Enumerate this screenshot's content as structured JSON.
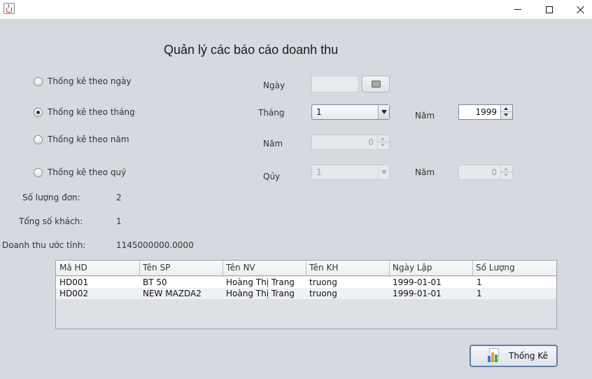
{
  "window": {
    "controls": [
      "minimize",
      "maximize",
      "close"
    ]
  },
  "page_title": "Quản lý các báo cáo doanh thu",
  "radios": [
    {
      "label": "Thống kê theo ngày",
      "selected": false
    },
    {
      "label": "Thống kê theo tháng",
      "selected": true
    },
    {
      "label": "Thống kê theo năm",
      "selected": false
    },
    {
      "label": "Thống kê theo quý",
      "selected": false
    }
  ],
  "filters": {
    "day_label": "Ngày",
    "day_value": "",
    "month_label": "Tháng",
    "month_value": "1",
    "month_year_label": "Năm",
    "month_year_value": "1999",
    "year_label": "Năm",
    "year_value": "0",
    "quarter_label": "Qúy",
    "quarter_value": "1",
    "quarter_year_label": "Năm",
    "quarter_year_value": "0"
  },
  "stats": {
    "orders_label": "Số lượng đơn:",
    "orders_value": "2",
    "customers_label": "Tổng số khách:",
    "customers_value": "1",
    "revenue_label": "Doanh thu ước tính:",
    "revenue_value": "1145000000.0000"
  },
  "table": {
    "headers": [
      "Mã HD",
      "Tên SP",
      "Tên NV",
      "Tên KH",
      "Ngày Lập",
      "Số Lượng"
    ],
    "rows": [
      [
        "HD001",
        "BT 50",
        "Hoàng Thị Trang",
        "truong",
        "1999-01-01",
        "1"
      ],
      [
        "HD002",
        "NEW MAZDA2",
        "Hoàng Thị Trang",
        "truong",
        "1999-01-01",
        "1"
      ]
    ]
  },
  "stat_button": {
    "label": "Thống Kê",
    "icon": "bar-chart-icon"
  }
}
